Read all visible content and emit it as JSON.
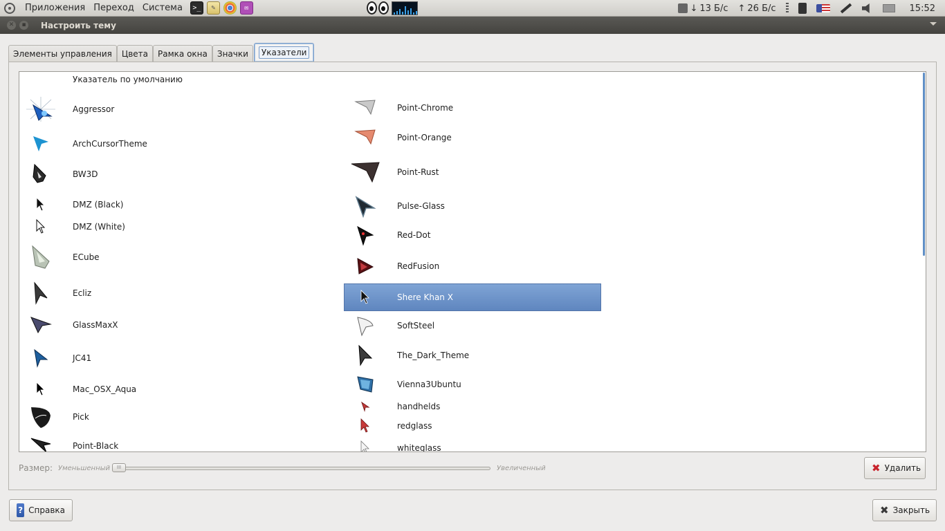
{
  "panel": {
    "menus": [
      "Приложения",
      "Переход",
      "Система"
    ],
    "net_down": "13 Б/с",
    "net_up": "26 Б/с",
    "clock": "15:52"
  },
  "window": {
    "title": "Настроить тему"
  },
  "tabs": [
    {
      "label": "Элементы управления",
      "active": false
    },
    {
      "label": "Цвета",
      "active": false
    },
    {
      "label": "Рамка окна",
      "active": false
    },
    {
      "label": "Значки",
      "active": false
    },
    {
      "label": "Указатели",
      "active": true
    }
  ],
  "cursors": {
    "left": [
      {
        "label": "Указатель по умолчанию",
        "icon": "none"
      },
      {
        "label": "Aggressor",
        "icon": "aggressor-cursor-icon"
      },
      {
        "label": "ArchCursorTheme",
        "icon": "arch-cursor-icon"
      },
      {
        "label": "BW3D",
        "icon": "bw3d-cursor-icon"
      },
      {
        "label": "DMZ (Black)",
        "icon": "dmz-black-cursor-icon"
      },
      {
        "label": "DMZ (White)",
        "icon": "dmz-white-cursor-icon"
      },
      {
        "label": "ECube",
        "icon": "ecube-cursor-icon"
      },
      {
        "label": "Ecliz",
        "icon": "ecliz-cursor-icon"
      },
      {
        "label": "GlassMaxX",
        "icon": "glassmaxx-cursor-icon"
      },
      {
        "label": "JC41",
        "icon": "jc41-cursor-icon"
      },
      {
        "label": "Mac_OSX_Aqua",
        "icon": "mac-osx-aqua-cursor-icon"
      },
      {
        "label": "Pick",
        "icon": "pick-cursor-icon"
      },
      {
        "label": "Point-Black",
        "icon": "point-black-cursor-icon"
      }
    ],
    "right": [
      {
        "label": "Point-Chrome",
        "icon": "point-chrome-cursor-icon"
      },
      {
        "label": "Point-Orange",
        "icon": "point-orange-cursor-icon"
      },
      {
        "label": "Point-Rust",
        "icon": "point-rust-cursor-icon"
      },
      {
        "label": "Pulse-Glass",
        "icon": "pulse-glass-cursor-icon"
      },
      {
        "label": "Red-Dot",
        "icon": "red-dot-cursor-icon"
      },
      {
        "label": "RedFusion",
        "icon": "redfusion-cursor-icon"
      },
      {
        "label": "Shere Khan X",
        "icon": "shere-khan-x-cursor-icon",
        "selected": true
      },
      {
        "label": "SoftSteel",
        "icon": "softsteel-cursor-icon"
      },
      {
        "label": "The_Dark_Theme",
        "icon": "the-dark-theme-cursor-icon"
      },
      {
        "label": "Vienna3Ubuntu",
        "icon": "vienna3ubuntu-cursor-icon"
      },
      {
        "label": "handhelds",
        "icon": "handhelds-cursor-icon"
      },
      {
        "label": "redglass",
        "icon": "redglass-cursor-icon"
      },
      {
        "label": "whiteglass",
        "icon": "whiteglass-cursor-icon"
      }
    ]
  },
  "size": {
    "label": "Размер:",
    "min_label": "Уменьшенный",
    "max_label": "Увеличенный",
    "value_fraction": 0.0
  },
  "buttons": {
    "delete": "Удалить",
    "help": "Справка",
    "close": "Закрыть"
  },
  "colors": {
    "selection": "#6f95cc",
    "panel_bg": "#d8d7d3",
    "titlebar_bg": "#4d4c48"
  }
}
